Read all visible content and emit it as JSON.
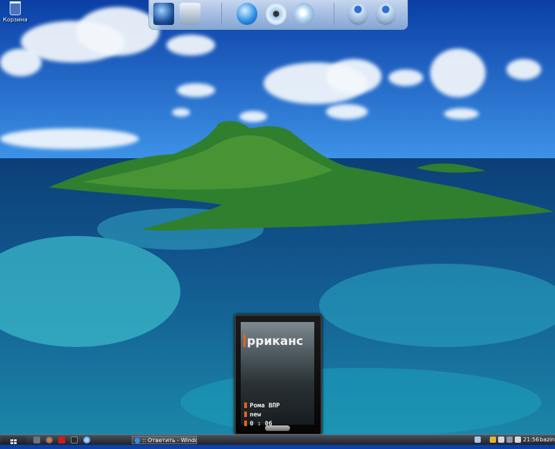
{
  "desktop": {
    "recycle_bin_label": "Корзина",
    "launcher_icons": [
      "media-icon",
      "folder-icon",
      "internet-explorer-icon",
      "eye-icon",
      "settings-disc-icon",
      "joystick-icon",
      "joystick-alert-icon"
    ]
  },
  "widget": {
    "scroll_title": "рриканс",
    "artist": "Рома ВПР",
    "track": "new",
    "time": "0 : 06"
  },
  "taskbar": {
    "task_label": ":: Ответить - Windo...",
    "clock": "21:56",
    "user": "bazin",
    "quick_launch": [
      "show-desktop-icon",
      "firefox-icon",
      "media-player-icon",
      "winamp-icon",
      "internet-explorer-icon"
    ]
  },
  "colors": {
    "accent_orange": "#e8631c",
    "taskbar_dark": "#1f2228"
  }
}
